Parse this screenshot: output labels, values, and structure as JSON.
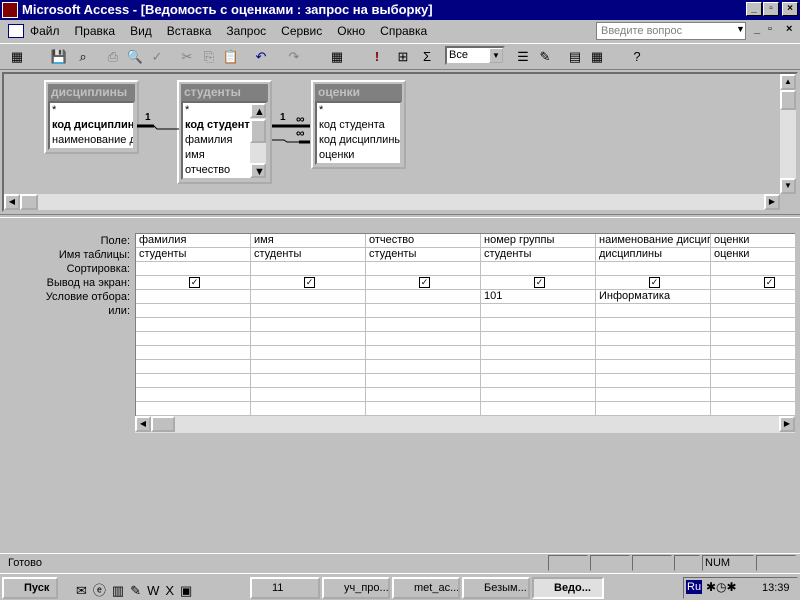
{
  "window": {
    "title": "Microsoft Access - [Ведомость с оценками : запрос на выборку]"
  },
  "menu": [
    "Файл",
    "Правка",
    "Вид",
    "Вставка",
    "Запрос",
    "Сервис",
    "Окно",
    "Справка"
  ],
  "help_placeholder": "Введите вопрос",
  "toolbar": {
    "top_values": "Все"
  },
  "tables": [
    {
      "name": "дисциплины",
      "fields": [
        "*",
        "код дисциплины",
        "наименование д"
      ]
    },
    {
      "name": "студенты",
      "fields": [
        "*",
        "код студента",
        "фамилия",
        "имя",
        "отчество"
      ]
    },
    {
      "name": "оценки",
      "fields": [
        "*",
        "код студента",
        "код дисциплины",
        "оценки"
      ]
    }
  ],
  "relations": {
    "one": "1",
    "many": "∞"
  },
  "grid": {
    "row_labels": [
      "Поле:",
      "Имя таблицы:",
      "Сортировка:",
      "Вывод на экран:",
      "Условие отбора:",
      "или:"
    ],
    "columns": [
      {
        "field": "фамилия",
        "table": "студенты",
        "sort": "",
        "show": true,
        "criteria": ""
      },
      {
        "field": "имя",
        "table": "студенты",
        "sort": "",
        "show": true,
        "criteria": ""
      },
      {
        "field": "отчество",
        "table": "студенты",
        "sort": "",
        "show": true,
        "criteria": ""
      },
      {
        "field": "номер группы",
        "table": "студенты",
        "sort": "",
        "show": true,
        "criteria": "101"
      },
      {
        "field": "наименование дисциплины",
        "table": "дисциплины",
        "sort": "",
        "show": true,
        "criteria": "Информатика"
      },
      {
        "field": "оценки",
        "table": "оценки",
        "sort": "",
        "show": true,
        "criteria": ""
      }
    ]
  },
  "status": {
    "text": "Готово",
    "num": "NUM"
  },
  "taskbar": {
    "start": "Пуск",
    "buttons": [
      "11",
      "уч_про...",
      "met_ac...",
      "Безым...",
      "Ведо..."
    ],
    "lang": "Ru",
    "clock": "13:39"
  }
}
